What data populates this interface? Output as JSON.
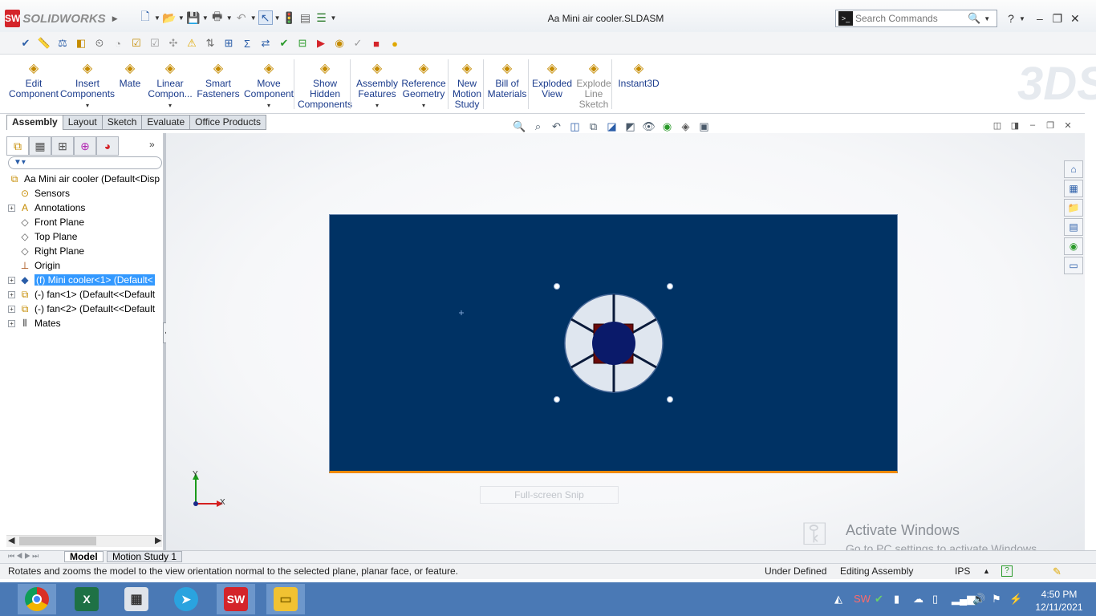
{
  "app": {
    "name": "SOLIDWORKS",
    "logo_mark": "SW"
  },
  "document": {
    "title": "Aa Mini air cooler.SLDASM"
  },
  "search": {
    "placeholder": "Search Commands"
  },
  "ribbon": [
    {
      "id": "edit-component",
      "label": "Edit\nComponent",
      "icon": "edit-component-icon"
    },
    {
      "id": "insert-components",
      "label": "Insert\nComponents",
      "icon": "insert-components-icon",
      "dropdown": true
    },
    {
      "id": "mate",
      "label": "Mate",
      "icon": "mate-icon"
    },
    {
      "id": "linear-component",
      "label": "Linear\nCompon...",
      "icon": "linear-pattern-icon",
      "dropdown": true
    },
    {
      "id": "smart-fasteners",
      "label": "Smart\nFasteners",
      "icon": "smart-fasteners-icon"
    },
    {
      "id": "move-component",
      "label": "Move\nComponent",
      "icon": "move-component-icon",
      "dropdown": true
    },
    {
      "id": "show-hidden",
      "label": "Show\nHidden\nComponents",
      "icon": "show-hidden-icon"
    },
    {
      "id": "assembly-features",
      "label": "Assembly\nFeatures",
      "icon": "assembly-features-icon",
      "dropdown": true
    },
    {
      "id": "reference-geometry",
      "label": "Reference\nGeometry",
      "icon": "reference-geometry-icon",
      "dropdown": true
    },
    {
      "id": "new-motion-study",
      "label": "New\nMotion\nStudy",
      "icon": "motion-study-icon"
    },
    {
      "id": "bill-of-materials",
      "label": "Bill of\nMaterials",
      "icon": "bom-icon"
    },
    {
      "id": "exploded-view",
      "label": "Exploded\nView",
      "icon": "exploded-view-icon"
    },
    {
      "id": "explode-line-sketch",
      "label": "Explode\nLine\nSketch",
      "icon": "explode-line-icon",
      "disabled": true
    },
    {
      "id": "instant3d",
      "label": "Instant3D",
      "icon": "instant3d-icon"
    }
  ],
  "command_tabs": [
    "Assembly",
    "Layout",
    "Sketch",
    "Evaluate",
    "Office Products"
  ],
  "tree": {
    "root": "Aa Mini air cooler  (Default<Disp",
    "items": [
      {
        "label": "Sensors",
        "icon": "sensors-icon",
        "expandable": false
      },
      {
        "label": "Annotations",
        "icon": "annotations-icon",
        "expandable": true
      },
      {
        "label": "Front Plane",
        "icon": "plane-icon",
        "expandable": false
      },
      {
        "label": "Top Plane",
        "icon": "plane-icon",
        "expandable": false
      },
      {
        "label": "Right Plane",
        "icon": "plane-icon",
        "expandable": false
      },
      {
        "label": "Origin",
        "icon": "origin-icon",
        "expandable": false
      },
      {
        "label": "(f) Mini cooler<1> (Default<",
        "icon": "part-icon",
        "expandable": true,
        "selected": true
      },
      {
        "label": "(-) fan<1> (Default<<Default",
        "icon": "subassembly-icon",
        "expandable": true
      },
      {
        "label": "(-) fan<2> (Default<<Default",
        "icon": "subassembly-icon",
        "expandable": true
      },
      {
        "label": "Mates",
        "icon": "mates-icon",
        "expandable": true
      }
    ]
  },
  "viewport": {
    "plate_color": "#003264",
    "edge_color": "#f08a00",
    "snip_text": "Full-screen Snip",
    "triad": {
      "x": "X",
      "y": "Y"
    }
  },
  "watermark": {
    "line1": "Activate Windows",
    "line2": "Go to PC settings to activate Windows."
  },
  "bottom_tabs": [
    "Model",
    "Motion Study 1"
  ],
  "status": {
    "message": "Rotates and zooms the model to the view orientation normal to the selected plane, planar face, or feature.",
    "definition": "Under Defined",
    "mode": "Editing Assembly",
    "units": "IPS",
    "units_arrow": "▲",
    "help": "?"
  },
  "taskbar": {
    "apps": [
      {
        "name": "chrome-app",
        "icon": "chrome-icon"
      },
      {
        "name": "excel-app",
        "icon": "excel-icon",
        "label": "X"
      },
      {
        "name": "calculator-app",
        "icon": "calculator-icon"
      },
      {
        "name": "telegram-app",
        "icon": "telegram-icon"
      },
      {
        "name": "solidworks-app",
        "icon": "solidworks-icon",
        "label": "SW"
      },
      {
        "name": "explorer-app",
        "icon": "folder-icon"
      }
    ],
    "time": "4:50 PM",
    "date": "12/11/2021"
  },
  "colors": {
    "accent": "#2a5da8",
    "selection": "#3399ff",
    "taskbar": "#4a79b5"
  }
}
